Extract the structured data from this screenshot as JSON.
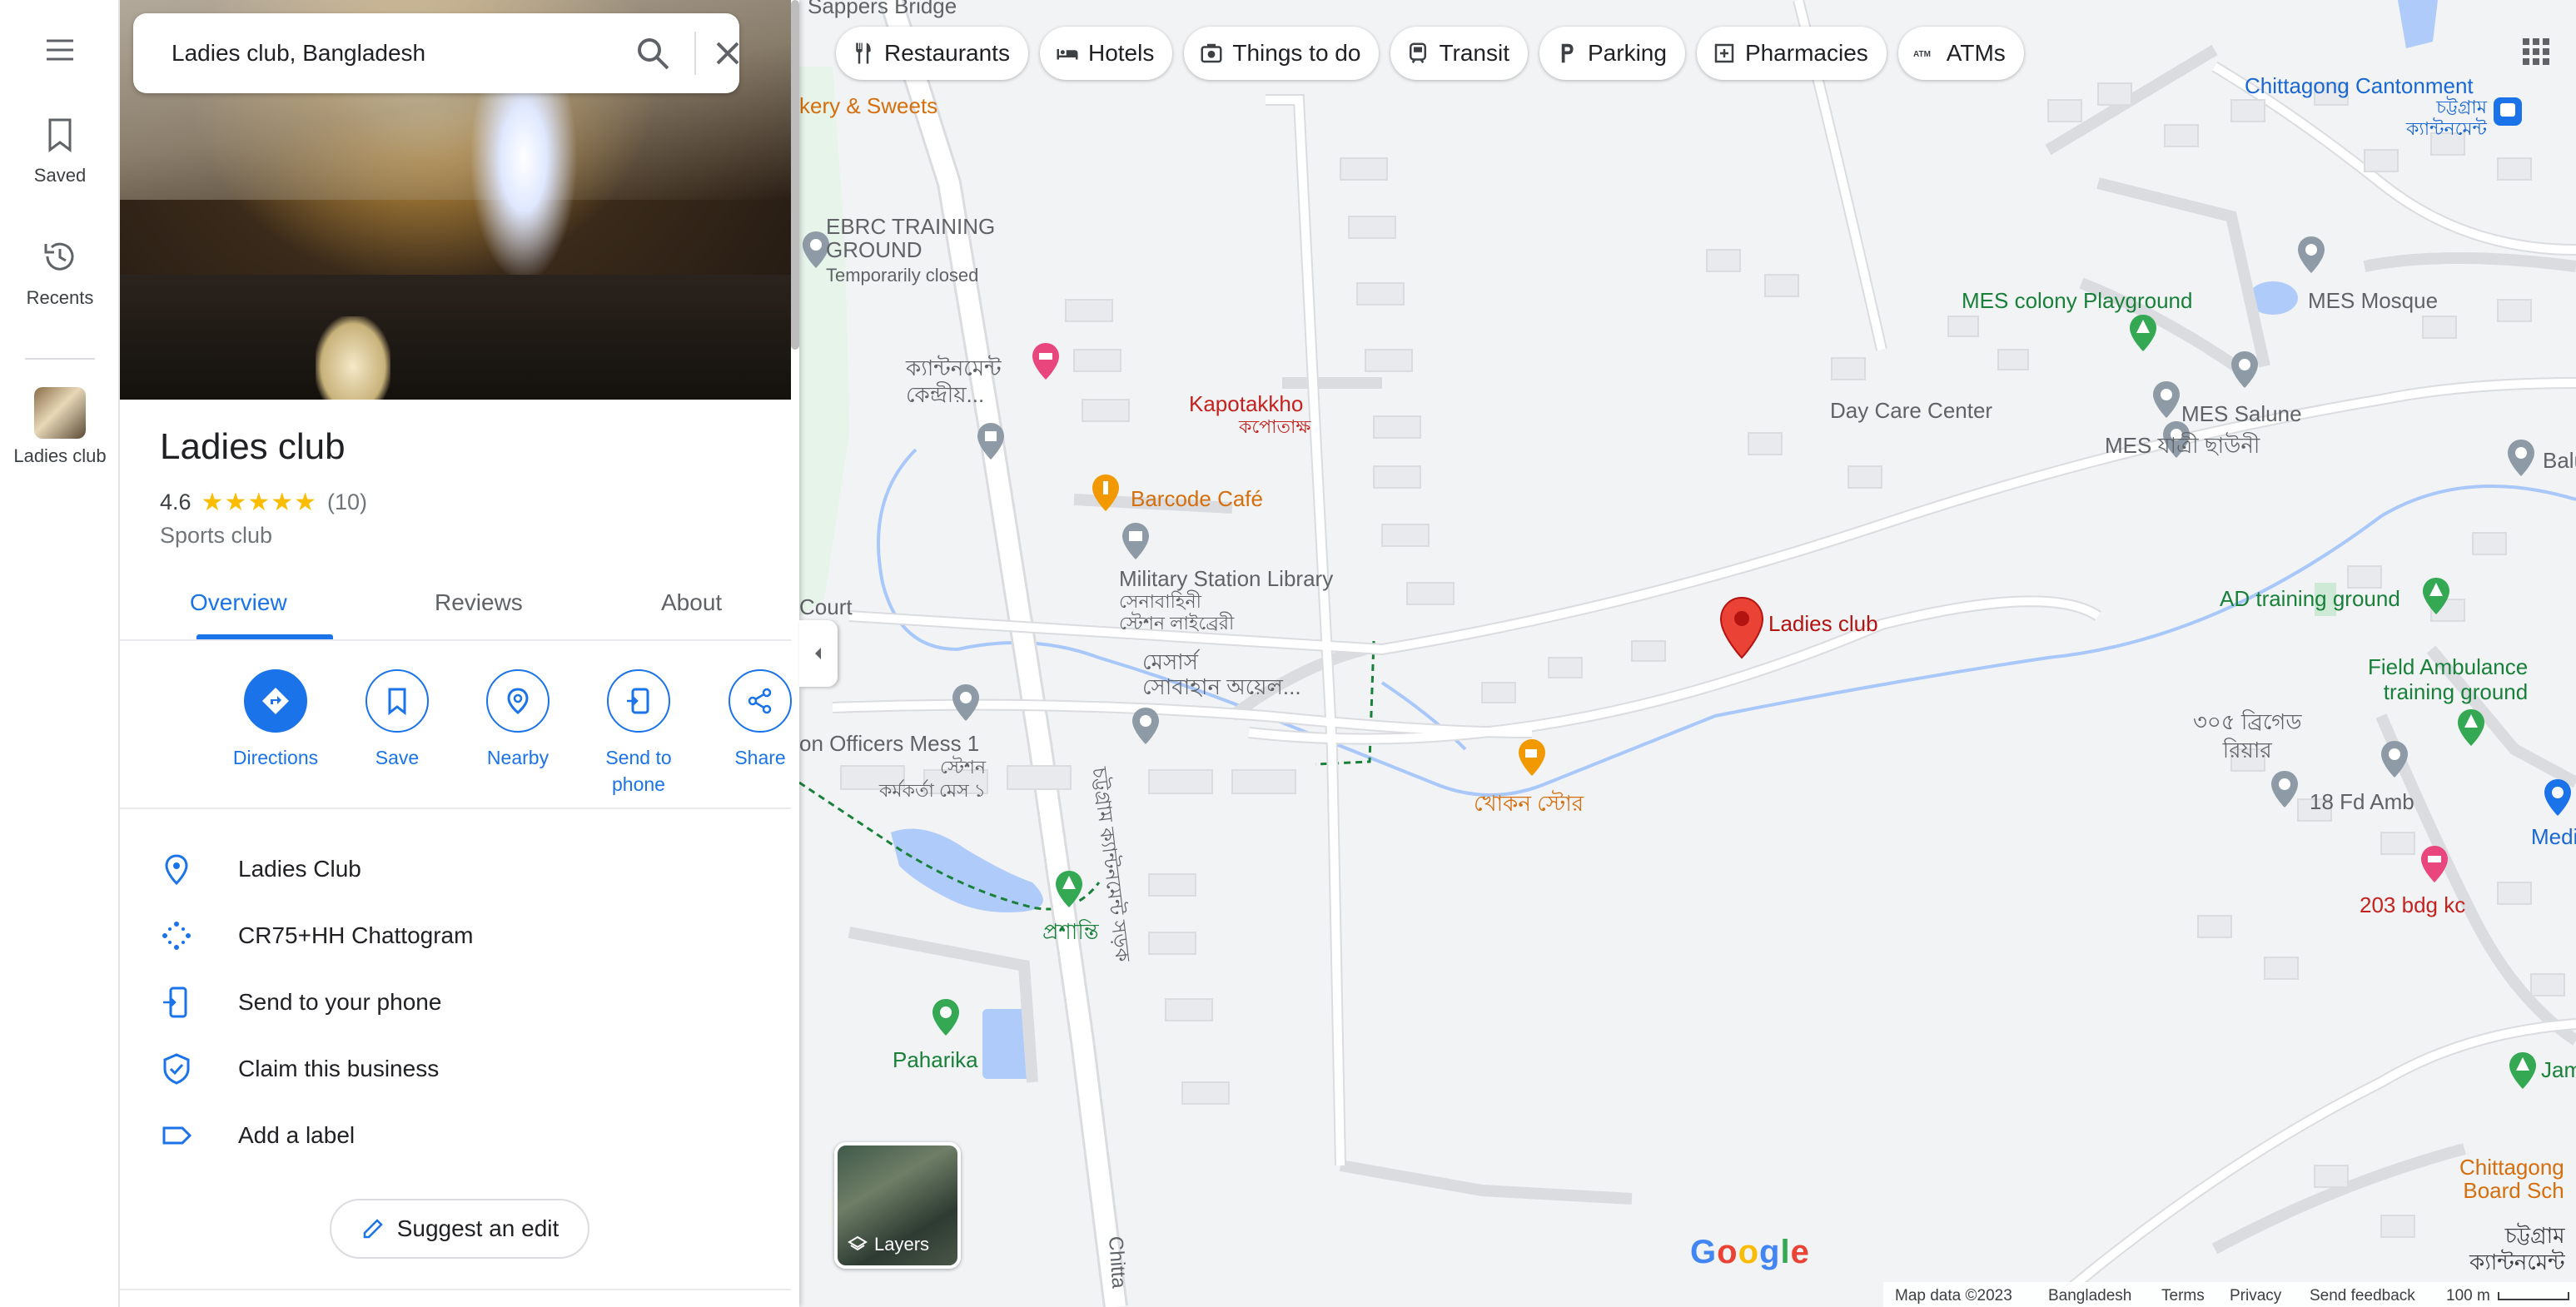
{
  "search": {
    "query": "Ladies club, Bangladesh"
  },
  "rail": {
    "saved_label": "Saved",
    "recents_label": "Recents",
    "recent_place_label": "Ladies club"
  },
  "place": {
    "name": "Ladies club",
    "rating": "4.6",
    "stars": "★★★★★",
    "review_count": "(10)",
    "category": "Sports club"
  },
  "tabs": [
    "Overview",
    "Reviews",
    "About"
  ],
  "actions": [
    {
      "label": "Directions"
    },
    {
      "label": "Save"
    },
    {
      "label": "Nearby"
    },
    {
      "label": "Send to\nphone"
    },
    {
      "label": "Share"
    }
  ],
  "info_rows": [
    {
      "text": "Ladies Club",
      "icon": "location-pin-icon"
    },
    {
      "text": "CR75+HH Chattogram",
      "icon": "plus-code-icon"
    },
    {
      "text": "Send to your phone",
      "icon": "phone-send-icon"
    },
    {
      "text": "Claim this business",
      "icon": "shield-check-icon"
    },
    {
      "text": "Add a label",
      "icon": "label-icon"
    }
  ],
  "suggest_edit": "Suggest an edit",
  "chips": [
    {
      "label": "Restaurants",
      "icon": "fork-knife-icon"
    },
    {
      "label": "Hotels",
      "icon": "bed-icon"
    },
    {
      "label": "Things to do",
      "icon": "camera-icon"
    },
    {
      "label": "Transit",
      "icon": "train-icon"
    },
    {
      "label": "Parking",
      "icon": "parking-icon"
    },
    {
      "label": "Pharmacies",
      "icon": "pharmacy-icon"
    },
    {
      "label": "ATMs",
      "icon": "atm-icon"
    }
  ],
  "map_labels": {
    "sappers_bridge": "Sappers Bridge",
    "bakery": "kery & Sweets",
    "ebrc": "EBRC TRAINING\nGROUND",
    "ebrc_status": "Temporarily closed",
    "cantonment_central": "ক্যান্টনমেন্ট\nকেন্দ্রীয়...",
    "kapotakkho": "Kapotakkho",
    "kapotakkho_bn": "কপোতাক্ষ",
    "barcode_cafe": "Barcode Café",
    "military_library": "Military Station Library",
    "military_library_bn": "সেনাবাহিনী\nস্টেশন লাইব্রেরী",
    "court": "Court",
    "messrs": "মেসার্স\nসোবাহান অয়েল...",
    "officers_mess": "on Officers Mess 1",
    "officers_mess_bn": "স্টেশন\nকর্মকর্তা মেস ১",
    "prashanti": "প্রশান্তি",
    "paharika": "Paharika",
    "road_bn": "চট্টগ্রাম ক্যান্টনমেন্ট সড়ক",
    "road_bottom": "Chitta",
    "khokon_store": "খোকন স্টোর",
    "ladies_club": "Ladies club",
    "day_care": "Day Care Center",
    "mes_colony": "MES colony Playground",
    "mes_mosque": "MES Mosque",
    "mes_salune": "MES Salune",
    "mes_jatri": "MES যাত্রী ছাউনী",
    "balu": "Balu",
    "ctg_cantonment": "Chittagong Cantonment",
    "ctg_cantonment_bn": "চট্টগ্রাম\nক্যান্টনমেন্ট",
    "ad_training": "AD training ground",
    "field_ambulance": "Field Ambulance\ntraining ground",
    "brigade_bn": "৩০৫ ব্রিগেড\nরিয়ার",
    "fd_amb": "18 Fd Amb",
    "medi": "Medi",
    "bdg_kc": "203 bdg kc",
    "jam": "Jam",
    "ctg_board": "Chittagong\nBoard Sch",
    "ctg_cantonment_bn2": "চট্টগ্রাম\nক্যান্টনমেন্ট"
  },
  "layers_label": "Layers",
  "google_logo": "Google",
  "footer": {
    "map_data": "Map data ©2023",
    "country": "Bangladesh",
    "terms": "Terms",
    "privacy": "Privacy",
    "feedback": "Send feedback",
    "scale": "100 m"
  },
  "colors": {
    "accent": "#1a73e8",
    "star": "#fbbc04",
    "pin_red": "#ea4335",
    "park_green": "#34a853",
    "food_orange": "#f29900",
    "hotel_pink": "#e8467c",
    "water_blue": "#aecbfa"
  }
}
